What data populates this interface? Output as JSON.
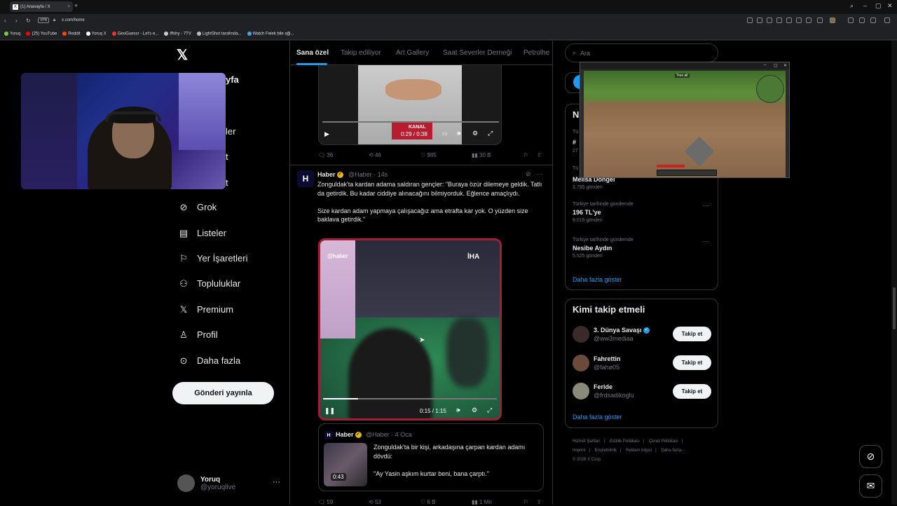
{
  "browser": {
    "tab_title": "(1) Anasayfa / X",
    "url": "x.com/home",
    "vpn_label": "VPN",
    "bookmarks": [
      "Yoruq",
      "(25) YouTube",
      "Reddit",
      "Yoruq X",
      "GeoGuessr - Let's e...",
      "Iffshy - 7TV",
      "LightShot tarafında...",
      "Watch Felek bile ağl..."
    ]
  },
  "sidebar": {
    "items": [
      {
        "label": "Grok",
        "icon": "grok-icon"
      },
      {
        "label": "Listeler",
        "icon": "list-icon"
      },
      {
        "label": "Yer İşaretleri",
        "icon": "bookmark-icon"
      },
      {
        "label": "Topluluklar",
        "icon": "communities-icon"
      },
      {
        "label": "Premium",
        "icon": "x-premium-icon"
      },
      {
        "label": "Profil",
        "icon": "profile-icon"
      },
      {
        "label": "Daha fazla",
        "icon": "more-circle-icon"
      }
    ],
    "partial_labels": [
      "yfa",
      "ler",
      "t",
      "t"
    ],
    "post_button": "Gönderi yayınla",
    "account": {
      "name": "Yoruq",
      "handle": "@yoruqlive"
    }
  },
  "timeline": {
    "tabs": [
      "Sana özel",
      "Takip ediliyor",
      "Art Gallery",
      "Saat Severler Derneği",
      "Petrolhe"
    ],
    "post1": {
      "video_time": "0:29 / 0:38",
      "watermark": "KANAL",
      "stats": {
        "replies": "36",
        "reposts": "46",
        "likes": "985",
        "views": "30 B"
      }
    },
    "post2": {
      "avatar_letter": "H",
      "name": "Haber",
      "meta": "@Haber · 14s",
      "text": "Zonguldak'ta kardan adama saldıran gençler: \"Buraya özür dilemeye geldik. Tatlı da getirdik. Bu kadar ciddiye alınacağını bilmiyorduk. Eğlence amaçlıydı.\n\nSize kardan adam yapmaya çalışacağız ama etrafta kar yok. O yüzden size baklava getirdik.\"",
      "video_time": "0:15 / 1:15",
      "watermark_left": "@haber",
      "watermark_right": "İHA",
      "quote": {
        "avatar_letter": "H",
        "name": "Haber",
        "meta": "@Haber · 4 Oca",
        "text": "Zonguldak'ta bir kişi, arkadaşına çarpan kardan adamı dövdü:\n\n\"Ay Yasin aşkım kurtar beni, bana çarptı.\"",
        "duration": "0:43"
      },
      "stats": {
        "replies": "59",
        "reposts": "53",
        "likes": "6 B",
        "views": "1 Mn"
      }
    }
  },
  "right": {
    "search_placeholder": "Ara",
    "trends_partial": [
      "N",
      "Tü",
      "#",
      "27",
      "Tü"
    ],
    "trends": [
      {
        "category": "",
        "title": "Melisa Döngel",
        "count": "3.795 gönderi"
      },
      {
        "category": "Türkiye tarihinde gündemde",
        "title": "196 TL'ye",
        "count": "9.016 gönderi"
      },
      {
        "category": "Türkiye tarihinde gündemde",
        "title": "Nesibe Aydın",
        "count": "5.525 gönderi"
      }
    ],
    "show_more": "Daha fazla göster",
    "who_to_follow_title": "Kimi takip etmeli",
    "who_to_follow": [
      {
        "name": "3. Dünya Savaşı",
        "handle": "@ww3mediaa",
        "verified": true
      },
      {
        "name": "Fahrettin",
        "handle": "@fahø05",
        "verified": false
      },
      {
        "name": "Feride",
        "handle": "@frdsadikoglu",
        "verified": false
      }
    ],
    "follow_label": "Takip et",
    "show_more_2": "Daha fazla göster",
    "footer": [
      "Hizmet Şartları",
      "|",
      "Gizlilik Politikası",
      "|",
      "Çerez Politikası",
      "|",
      "Imprint",
      "|",
      "Erişilebilirlik",
      "|",
      "Reklam bilgisi",
      "|",
      "Daha fazla ···",
      "© 2026 X Corp."
    ]
  },
  "game_window": {
    "tag": "Tree all"
  }
}
